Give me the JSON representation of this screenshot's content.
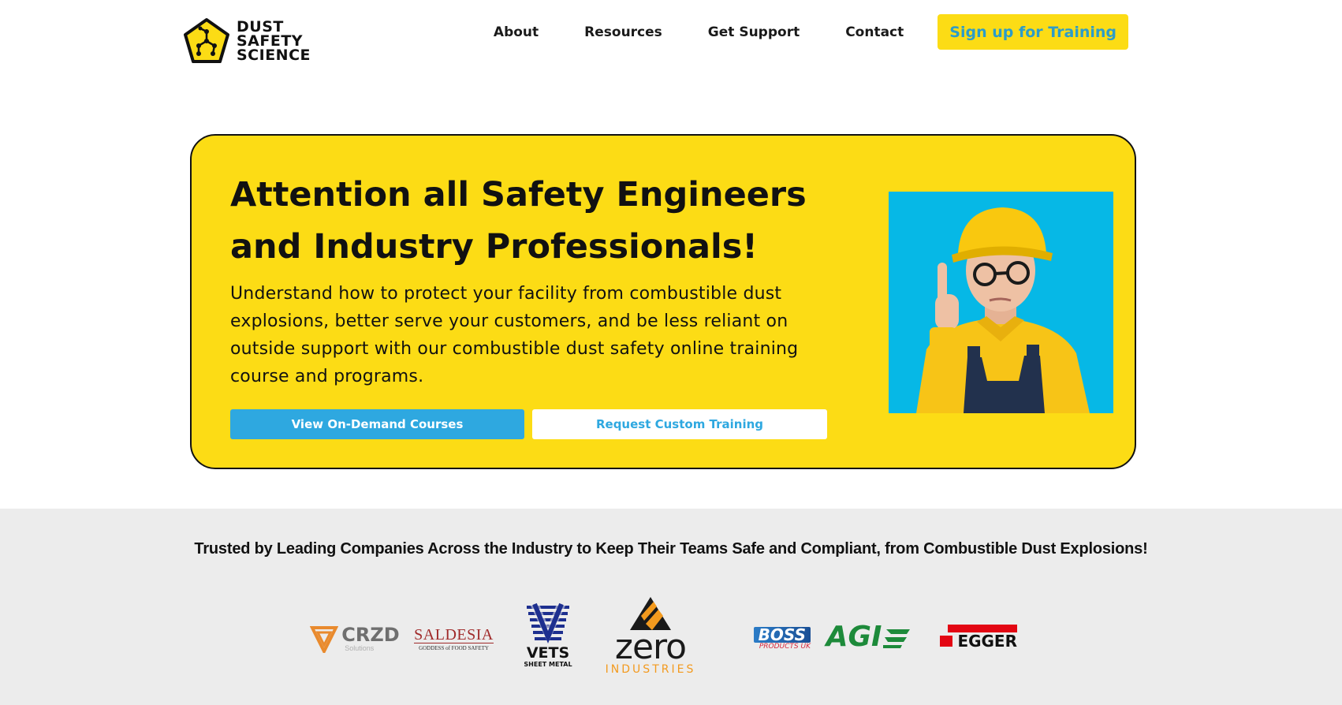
{
  "header": {
    "logo": {
      "line1": "DUST",
      "line2": "SAFETY",
      "line3": "SCIENCE"
    },
    "nav": [
      {
        "label": "About"
      },
      {
        "label": "Resources"
      },
      {
        "label": "Get Support"
      },
      {
        "label": "Contact"
      }
    ],
    "cta_label": "Sign up for Training"
  },
  "hero": {
    "title": "Attention all Safety Engineers and Industry Professionals!",
    "body": "Understand how to protect your facility from combustible dust explosions, better serve your customers, and be less reliant on outside support with our combustible dust safety online training course and programs.",
    "primary_button": "View On-Demand Courses",
    "secondary_button": "Request Custom Training"
  },
  "trusted": {
    "heading": "Trusted by Leading Companies Across the Industry to Keep Their Teams Safe and Compliant, from Combustible Dust Explosions!",
    "logos": [
      {
        "name": "CRZD",
        "sub": "Solutions"
      },
      {
        "name": "SALDESIA",
        "sub": "GODDESS of FOOD SAFETY"
      },
      {
        "name": "VETS",
        "sub": "SHEET METAL"
      },
      {
        "name": "zero",
        "sub": "INDUSTRIES"
      },
      {
        "name": "BOSS",
        "sub": "PRODUCTS UK"
      },
      {
        "name": "AGI",
        "sub": ""
      },
      {
        "name": "EGGER",
        "sub": ""
      }
    ]
  },
  "colors": {
    "brand_yellow": "#fcdc15",
    "brand_blue": "#2ea8e0",
    "photo_bg": "#06b8e6",
    "band_gray": "#ececec"
  },
  "icons": [
    "dust-molecule-logo-icon"
  ]
}
